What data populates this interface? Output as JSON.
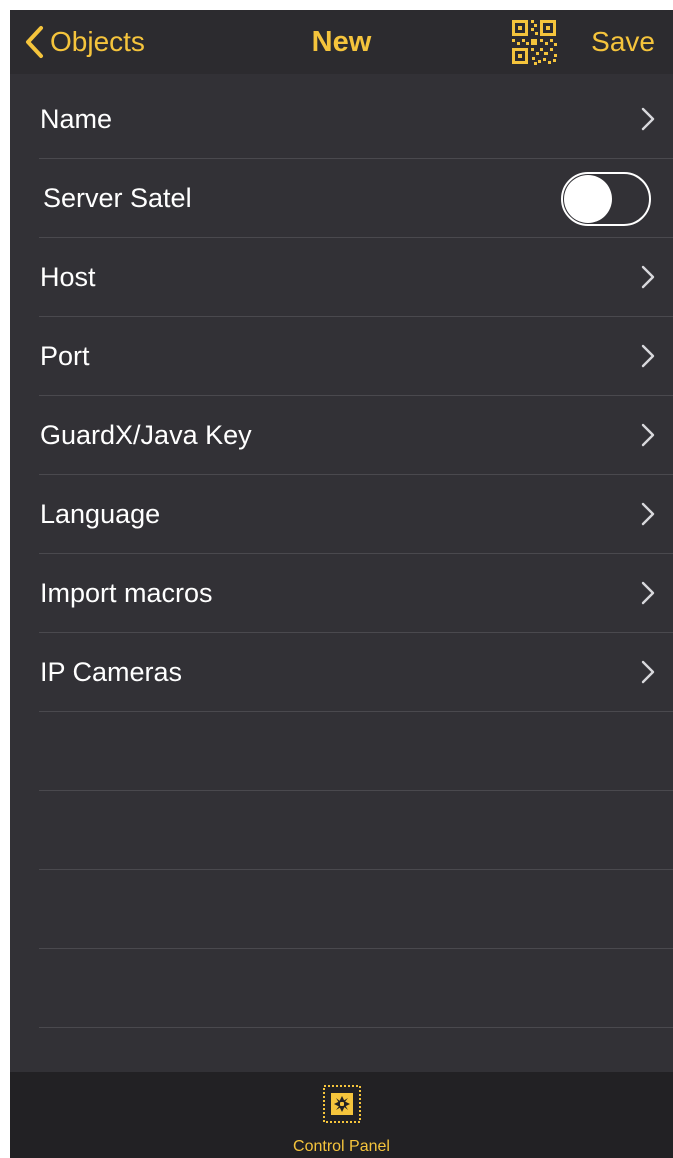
{
  "nav": {
    "back_label": "Objects",
    "title": "New",
    "save_label": "Save"
  },
  "rows": [
    {
      "label": "Name",
      "type": "disclosure"
    },
    {
      "label": "Server Satel",
      "type": "toggle",
      "value": false
    },
    {
      "label": "Host",
      "type": "disclosure"
    },
    {
      "label": "Port",
      "type": "disclosure"
    },
    {
      "label": "GuardX/Java Key",
      "type": "disclosure"
    },
    {
      "label": "Language",
      "type": "disclosure"
    },
    {
      "label": "Import macros",
      "type": "disclosure"
    },
    {
      "label": "IP Cameras",
      "type": "disclosure"
    }
  ],
  "tabbar": {
    "items": [
      {
        "label": "Control Panel",
        "icon": "control-panel-icon",
        "selected": true
      }
    ]
  },
  "colors": {
    "accent": "#f5c43c",
    "background": "#323136",
    "separator": "#4a494e",
    "tabbar": "#222124"
  }
}
